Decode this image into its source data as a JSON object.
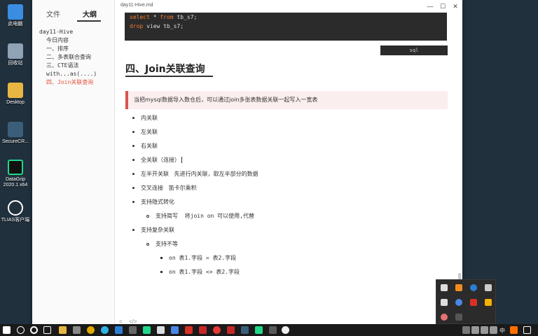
{
  "desktop": {
    "icons": [
      {
        "label": "此电脑",
        "icon": "computer-icon",
        "color": "#3a8de0"
      },
      {
        "label": "回收站",
        "icon": "recycle-bin-icon",
        "color": "#8fa3b5"
      },
      {
        "label": "Desktop",
        "icon": "folder-icon",
        "color": "#e8b642"
      },
      {
        "label": "SecureCR...",
        "icon": "securecrt-icon",
        "color": "#3b5f7a"
      },
      {
        "label": "DataGrip 2020.1 x64",
        "icon": "datagrip-icon",
        "color": "#21d789"
      },
      {
        "label": "TLIAS客户端",
        "icon": "tlias-icon",
        "color": "#ffffff"
      }
    ]
  },
  "window": {
    "title": "day11-Hive.md",
    "minimize": "—",
    "maximize": "☐",
    "close": "✕"
  },
  "sidebar": {
    "tabs": [
      "文件",
      "大纲"
    ],
    "outline": [
      {
        "text": "day11-Hive",
        "level": 0,
        "active": false
      },
      {
        "text": "今日内容",
        "level": 1,
        "active": false
      },
      {
        "text": "一、排序",
        "level": 1,
        "active": false
      },
      {
        "text": "二、多表联合查询",
        "level": 1,
        "active": false
      },
      {
        "text": "三、CTE语法",
        "level": 1,
        "active": false
      },
      {
        "text": "with...as(....)",
        "level": 1,
        "active": false
      },
      {
        "text": "四、Join关联查询",
        "level": 1,
        "active": true
      }
    ]
  },
  "content": {
    "code_lines": [
      {
        "kw1": "select",
        "mid": " * ",
        "kw2": "from",
        "rest": " tb_s7;"
      },
      {
        "kw1": "drop",
        "mid": " view tb_s7;",
        "kw2": "",
        "rest": ""
      }
    ],
    "code_lang": "sql",
    "heading": "四、Join关联查询",
    "callout": "当把mysql数据导入数仓后，可以通过join多张表数据关联一起写入一宽表",
    "list": [
      {
        "text": "内关联",
        "level": 1
      },
      {
        "text": "左关联",
        "level": 1
      },
      {
        "text": "右关联",
        "level": 1
      },
      {
        "text": "全关联（连接）",
        "level": 1
      },
      {
        "text": "左半开关联   先进行内关联，取左半部分的数据",
        "level": 1
      },
      {
        "text": "交叉连接   笛卡尔乘积",
        "level": 1
      },
      {
        "text": "支持隐式转化",
        "level": 1
      },
      {
        "text": "支持简写  将join on 可以使用,代替",
        "level": 2
      },
      {
        "text": "支持复杂关联",
        "level": 1
      },
      {
        "text": "支持不等",
        "level": 2
      },
      {
        "text": "on 表1.字段 = 表2.字段",
        "level": 3
      },
      {
        "text": "on 表1.字段 <> 表2.字段",
        "level": 3
      }
    ],
    "footer_left": "<",
    "footer_code": "</>"
  },
  "taskbar": {
    "ime": "中",
    "time_icon": "notification-icon"
  }
}
